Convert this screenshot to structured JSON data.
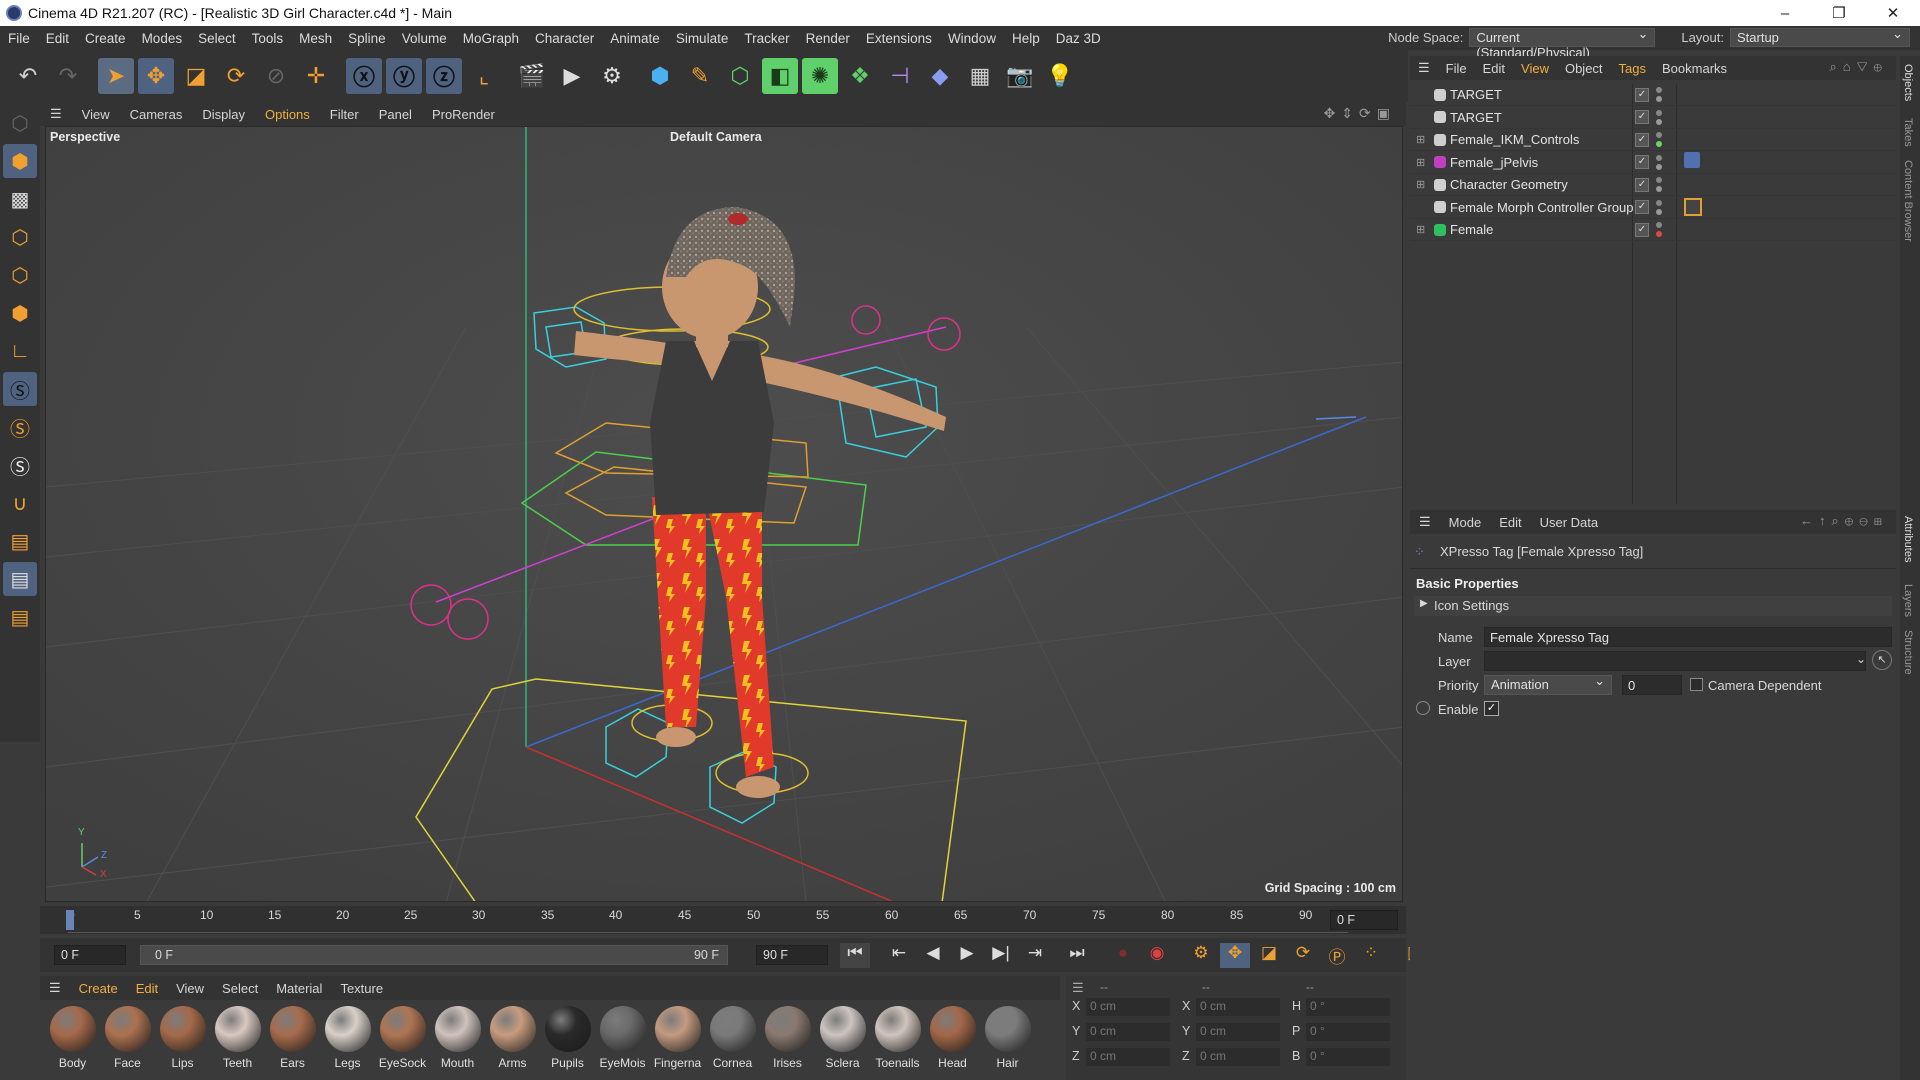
{
  "window": {
    "title": "Cinema 4D R21.207 (RC) - [Realistic 3D Girl Character.c4d *] - Main",
    "controls": [
      "–",
      "❐",
      "✕"
    ]
  },
  "menubar": {
    "items": [
      "File",
      "Edit",
      "Create",
      "Modes",
      "Select",
      "Tools",
      "Mesh",
      "Spline",
      "Volume",
      "MoGraph",
      "Character",
      "Animate",
      "Simulate",
      "Tracker",
      "Render",
      "Extensions",
      "Window",
      "Help",
      "Daz 3D"
    ],
    "node_space_label": "Node Space:",
    "node_space_value": "Current (Standard/Physical)",
    "layout_label": "Layout:",
    "layout_value": "Startup"
  },
  "viewport": {
    "menu": [
      "View",
      "Cameras",
      "Display",
      "Options",
      "Filter",
      "Panel",
      "ProRender"
    ],
    "view_name": "Perspective",
    "camera": "Default Camera",
    "grid_spacing": "Grid Spacing : 100 cm",
    "axis_labels": {
      "y": "Y",
      "z": "Z",
      "x": "X"
    }
  },
  "timeline": {
    "ticks": [
      "0",
      "5",
      "10",
      "15",
      "20",
      "25",
      "30",
      "35",
      "40",
      "45",
      "50",
      "55",
      "60",
      "65",
      "70",
      "75",
      "80",
      "85",
      "90"
    ],
    "current_frame": "0 F",
    "start_field": "0 F",
    "range_start": "0 F",
    "range_end": "90 F",
    "end_field": "90 F"
  },
  "materials": {
    "menu": [
      "Create",
      "Edit",
      "View",
      "Select",
      "Material",
      "Texture"
    ],
    "items": [
      {
        "label": "Body",
        "color": "#a66a4a"
      },
      {
        "label": "Face",
        "color": "#ad7250"
      },
      {
        "label": "Lips",
        "color": "#a56a4a"
      },
      {
        "label": "Teeth",
        "color": "#d8c8c0"
      },
      {
        "label": "Ears",
        "color": "#a86c4c"
      },
      {
        "label": "Legs",
        "color": "#d8d0c8"
      },
      {
        "label": "EyeSock",
        "color": "#b07552"
      },
      {
        "label": "Mouth",
        "color": "#d0c2bc"
      },
      {
        "label": "Arms",
        "color": "#c89c7e"
      },
      {
        "label": "Pupils",
        "color": "#2a2a2a"
      },
      {
        "label": "EyeMois",
        "color": "#6a6a6a"
      },
      {
        "label": "Fingerna",
        "color": "#c49a80"
      },
      {
        "label": "Cornea",
        "color": "#7a7a7a"
      },
      {
        "label": "Irises",
        "color": "#8a7a70"
      },
      {
        "label": "Sclera",
        "color": "#ccc4c0"
      },
      {
        "label": "Toenails",
        "color": "#d0c4bc"
      },
      {
        "label": "Head",
        "color": "#a46848"
      },
      {
        "label": "Hair",
        "color": "#7c7c7c"
      }
    ]
  },
  "coords": {
    "header": [
      "--",
      "--",
      "--"
    ],
    "rows": [
      {
        "a": "X",
        "av": "0 cm",
        "b": "X",
        "bv": "0 cm",
        "c": "H",
        "cv": "0 °"
      },
      {
        "a": "Y",
        "av": "0 cm",
        "b": "Y",
        "bv": "0 cm",
        "c": "P",
        "cv": "0 °"
      },
      {
        "a": "Z",
        "av": "0 cm",
        "b": "Z",
        "bv": "0 cm",
        "c": "B",
        "cv": "0 °"
      }
    ]
  },
  "objects": {
    "menu": [
      "File",
      "Edit",
      "View",
      "Object",
      "Tags",
      "Bookmarks"
    ],
    "rows": [
      {
        "name": "TARGET",
        "dot": "#9a9a9a",
        "icon": "#cfcfcf"
      },
      {
        "name": "TARGET",
        "dot": "#9a9a9a",
        "icon": "#cfcfcf"
      },
      {
        "name": "Female_IKM_Controls",
        "dot": "#6bd36b",
        "icon": "#cfcfcf"
      },
      {
        "name": "Female_jPelvis",
        "dot": "#9a9a9a",
        "icon": "#c040c0"
      },
      {
        "name": "Character Geometry",
        "dot": "#9a9a9a",
        "icon": "#cfcfcf"
      },
      {
        "name": "Female Morph Controller Group",
        "dot": "#9a9a9a",
        "icon": "#cfcfcf"
      },
      {
        "name": "Female",
        "dot": "#e04848",
        "icon": "#2fbf5f"
      }
    ]
  },
  "attributes": {
    "menu": [
      "Mode",
      "Edit",
      "User Data"
    ],
    "tag_title": "XPresso Tag [Female Xpresso Tag]",
    "section": "Basic Properties",
    "icon_settings": "Icon Settings",
    "name_label": "Name",
    "name_value": "Female Xpresso Tag",
    "layer_label": "Layer",
    "priority_label": "Priority",
    "priority_value": "Animation",
    "priority_number": "0",
    "camera_dependent": "Camera Dependent",
    "enable_label": "Enable"
  },
  "side_tabs": [
    "Objects",
    "Takes",
    "Content Browser",
    "Attributes",
    "Layers",
    "Structure"
  ]
}
